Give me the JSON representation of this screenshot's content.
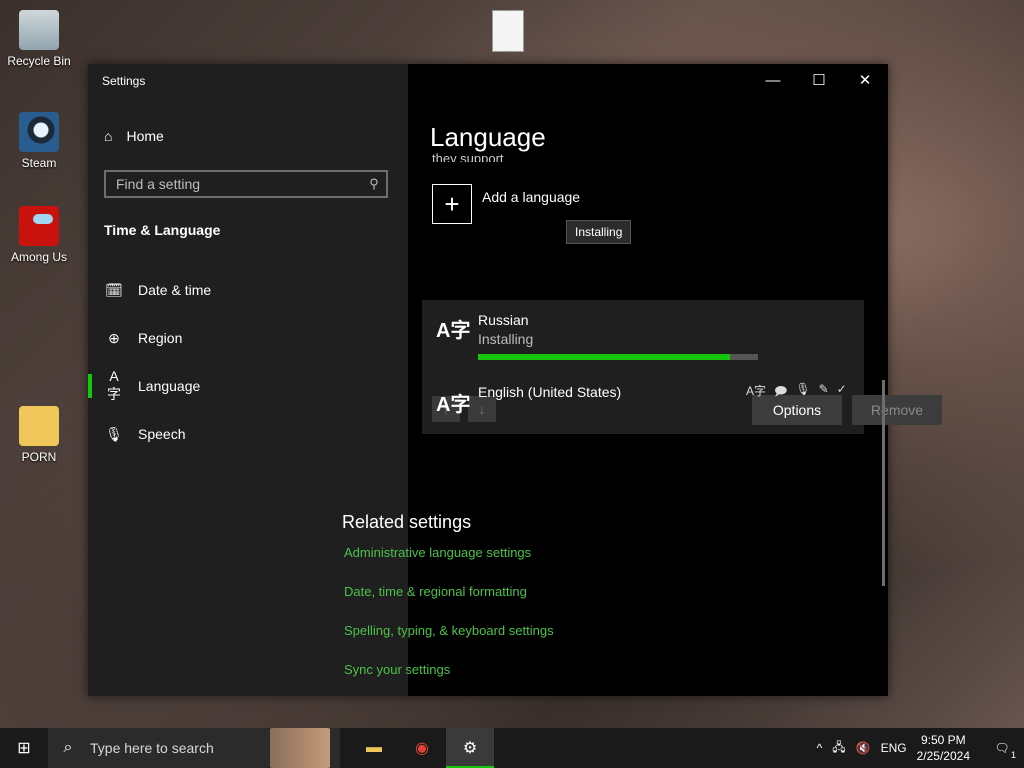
{
  "desktop": {
    "icons": [
      {
        "label": "Recycle Bin",
        "icon": "recycle-bin-icon"
      },
      {
        "label": "Steam",
        "icon": "steam-icon"
      },
      {
        "label": "Among Us",
        "icon": "among-us-icon"
      },
      {
        "label": "PORN",
        "icon": "folder-icon"
      }
    ]
  },
  "window": {
    "title": "Settings",
    "controls": {
      "minimize": "—",
      "maximize": "☐",
      "close": "✕"
    }
  },
  "sidebar": {
    "home": "Home",
    "search_placeholder": "Find a setting",
    "section": "Time & Language",
    "items": [
      {
        "label": "Date & time",
        "icon": "calendar-clock-icon"
      },
      {
        "label": "Region",
        "icon": "globe-icon"
      },
      {
        "label": "Language",
        "icon": "language-icon",
        "active": true
      },
      {
        "label": "Speech",
        "icon": "microphone-icon"
      }
    ]
  },
  "content": {
    "title": "Language",
    "cut_text": "they support",
    "add_language": "Add a language",
    "tooltip": "Installing",
    "installing_language": {
      "name": "Russian",
      "status": "Installing",
      "progress": 0.9,
      "options_label": "Options",
      "remove_label": "Remove"
    },
    "installed_language": {
      "name": "English (United States)"
    },
    "related_title": "Related settings",
    "links": [
      "Administrative language settings",
      "Date, time & regional formatting",
      "Spelling, typing, & keyboard settings",
      "Sync your settings"
    ]
  },
  "taskbar": {
    "search_placeholder": "Type here to search",
    "language": "ENG",
    "time": "9:50 PM",
    "date": "2/25/2024",
    "notifications": "1"
  },
  "colors": {
    "accent": "#16c60c",
    "link": "#4cc24a"
  }
}
